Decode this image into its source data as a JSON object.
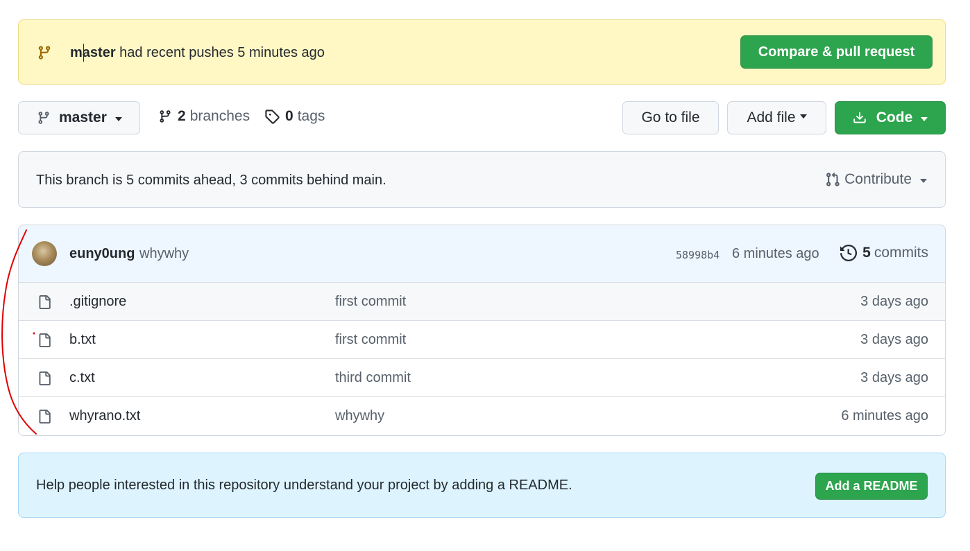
{
  "banner": {
    "branch": "master",
    "message": "had recent pushes 5 minutes ago",
    "compare_label": "Compare & pull request"
  },
  "toolbar": {
    "branch_label": "master",
    "branches_count": "2",
    "branches_label": "branches",
    "tags_count": "0",
    "tags_label": "tags",
    "go_to_file": "Go to file",
    "add_file": "Add file",
    "code": "Code"
  },
  "ahead_behind": {
    "text": "This branch is 5 commits ahead, 3 commits behind main.",
    "contribute_label": "Contribute"
  },
  "latest_commit": {
    "author": "euny0ung",
    "message": "whywhy",
    "sha": "58998b4",
    "time": "6 minutes ago",
    "commits_count": "5",
    "commits_label": "commits"
  },
  "files": [
    {
      "name": ".gitignore",
      "message": "first commit",
      "age": "3 days ago"
    },
    {
      "name": "b.txt",
      "message": "first commit",
      "age": "3 days ago"
    },
    {
      "name": "c.txt",
      "message": "third commit",
      "age": "3 days ago"
    },
    {
      "name": "whyrano.txt",
      "message": "whywhy",
      "age": "6 minutes ago"
    }
  ],
  "readme_prompt": {
    "text": "Help people interested in this repository understand your project by adding a README.",
    "button_label": "Add a README"
  },
  "colors": {
    "primary_green": "#2da44e",
    "banner_yellow": "#fff8c5",
    "commit_header_blue": "#eef6ff",
    "readme_blue": "#ddf4ff",
    "annotation_red": "#e00000"
  },
  "icons": [
    "git-branch-icon",
    "tag-icon",
    "download-icon",
    "git-pull-request-icon",
    "history-icon",
    "file-icon"
  ]
}
